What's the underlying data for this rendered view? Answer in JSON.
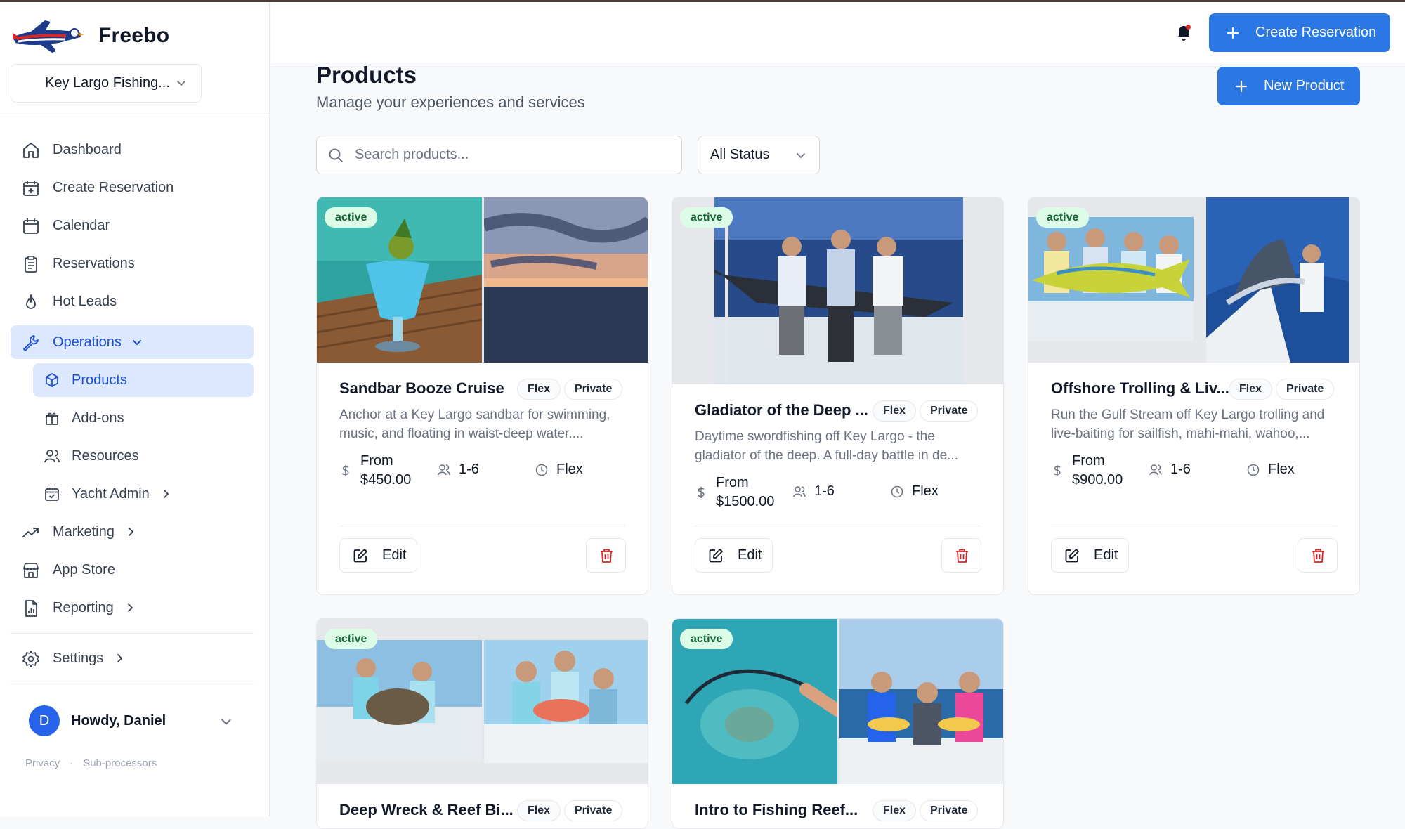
{
  "app": {
    "name": "Freebo",
    "org_selector": "Key Largo Fishing..."
  },
  "sidebar": {
    "items": [
      {
        "label": "Dashboard",
        "icon": "home-icon"
      },
      {
        "label": "Create Reservation",
        "icon": "calendar-plus-icon"
      },
      {
        "label": "Calendar",
        "icon": "calendar-icon"
      },
      {
        "label": "Reservations",
        "icon": "clipboard-icon"
      },
      {
        "label": "Hot Leads",
        "icon": "flame-icon"
      },
      {
        "label": "Operations",
        "icon": "wrench-icon",
        "expanded": true
      },
      {
        "label": "Marketing",
        "icon": "trending-up-icon"
      },
      {
        "label": "App Store",
        "icon": "store-icon"
      },
      {
        "label": "Reporting",
        "icon": "report-icon"
      },
      {
        "label": "Settings",
        "icon": "gear-icon"
      }
    ],
    "sub_items": [
      {
        "label": "Products",
        "icon": "box-icon",
        "active": true
      },
      {
        "label": "Add-ons",
        "icon": "gift-icon"
      },
      {
        "label": "Resources",
        "icon": "users-icon"
      },
      {
        "label": "Yacht Admin",
        "icon": "calendar-check-icon"
      }
    ],
    "user": {
      "initial": "D",
      "greeting": "Howdy, Daniel"
    },
    "legal": {
      "privacy": "Privacy",
      "separator": "·",
      "subprocessors": "Sub-processors"
    }
  },
  "header": {
    "create_reservation": "Create Reservation"
  },
  "page": {
    "title": "Products",
    "subtitle": "Manage your experiences and services",
    "new_product": "New Product",
    "search_placeholder": "Search products...",
    "status_filter": "All Status"
  },
  "products": [
    {
      "status": "active",
      "title": "Sandbar Booze Cruise",
      "tags": [
        "Flex",
        "Private"
      ],
      "desc_1": "Anchor at a Key Largo sandbar for swimming,",
      "desc_2": "music, and floating in waist-deep water....",
      "price_from": "From",
      "price": "$450.00",
      "capacity": "1-6",
      "duration": "Flex",
      "edit": "Edit"
    },
    {
      "status": "active",
      "title": "Gladiator of the Deep ...",
      "tags": [
        "Flex",
        "Private"
      ],
      "desc_1": "Daytime swordfishing off Key Largo - the",
      "desc_2": "gladiator of the deep. A full-day battle in de...",
      "price_from": "From",
      "price": "$1500.00",
      "capacity": "1-6",
      "duration": "Flex",
      "edit": "Edit"
    },
    {
      "status": "active",
      "title": "Offshore Trolling & Liv...",
      "tags": [
        "Flex",
        "Private"
      ],
      "desc_1": "Run the Gulf Stream off Key Largo trolling and",
      "desc_2": "live-baiting for sailfish, mahi-mahi, wahoo,...",
      "price_from": "From",
      "price": "$900.00",
      "capacity": "1-6",
      "duration": "Flex",
      "edit": "Edit"
    },
    {
      "status": "active",
      "title": "Deep Wreck & Reef Bi...",
      "tags": [
        "Flex",
        "Private"
      ]
    },
    {
      "status": "active",
      "title": "Intro to Fishing Reef...",
      "tags": [
        "Flex",
        "Private"
      ]
    }
  ],
  "colors": {
    "primary": "#2b78e4",
    "active_nav_bg": "#dbe8fd",
    "badge_bg": "#dcfce7",
    "badge_text": "#166534",
    "delete": "#dc2626"
  }
}
